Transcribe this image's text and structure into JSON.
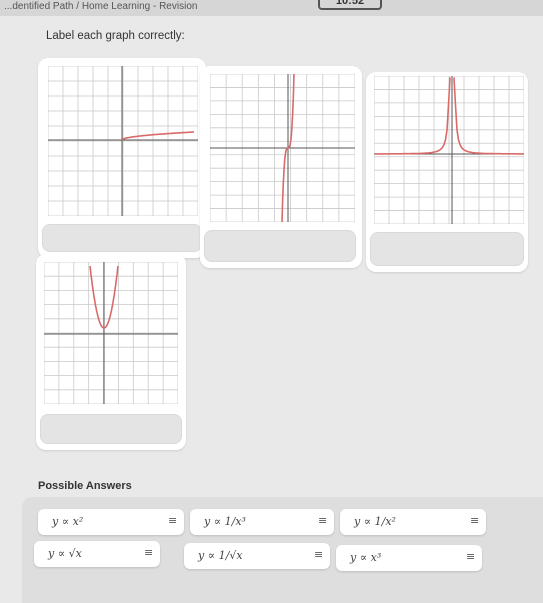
{
  "header": {
    "breadcrumb": "...dentified Path / Home Learning - Revision",
    "timer": "10:52"
  },
  "instruction": "Label each graph correctly:",
  "answers_title": "Possible Answers",
  "answers": [
    {
      "label": "y ∝ x²"
    },
    {
      "label": "y ∝ 1/x³"
    },
    {
      "label": "y ∝ 1/x²"
    },
    {
      "label": "y ∝ √x"
    },
    {
      "label": "y ∝ 1/√x"
    },
    {
      "label": "y ∝ x³"
    }
  ],
  "drag_handle_glyph": "≡",
  "graphs": [
    {
      "shape": "root-like"
    },
    {
      "shape": "cubic"
    },
    {
      "shape": "inverse-square"
    },
    {
      "shape": "quadratic"
    }
  ],
  "colors": {
    "curve": "#d96a6a",
    "grid": "#c9c9c9",
    "axis": "#555555",
    "card": "#ffffff",
    "drop_zone": "#e4e4e4",
    "panel": "#dedede"
  }
}
